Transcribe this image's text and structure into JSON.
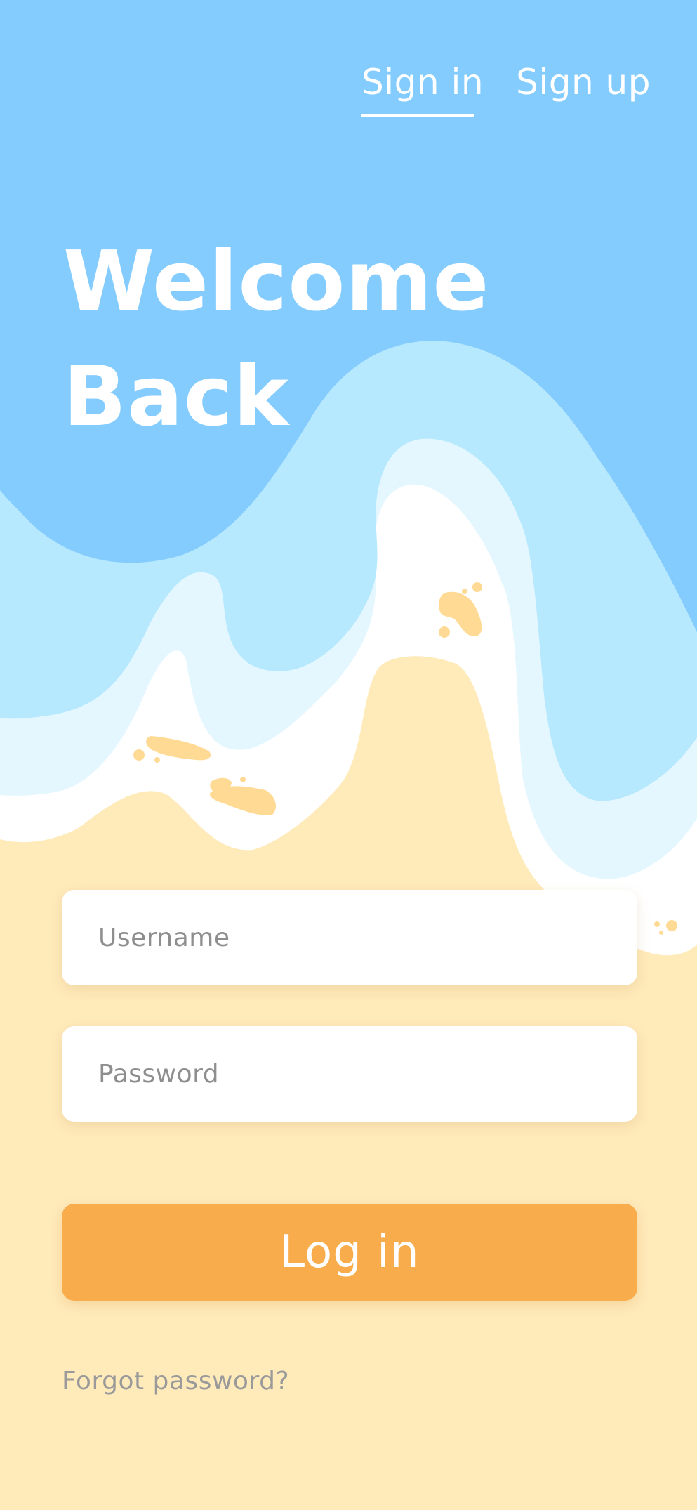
{
  "nav": {
    "tabs": [
      {
        "label": "Sign in",
        "active": true
      },
      {
        "label": "Sign up",
        "active": false
      }
    ]
  },
  "hero": {
    "title_line1": "Welcome",
    "title_line2": "Back"
  },
  "form": {
    "username": {
      "value": "",
      "placeholder": "Username"
    },
    "password": {
      "value": "",
      "placeholder": "Password"
    },
    "login_label": "Log in",
    "forgot_label": "Forgot password?"
  },
  "colors": {
    "sky": "#85CCFE",
    "wave_light": "#B7E9FE",
    "wave_pale": "#E4F7FF",
    "foam": "#FFFFFF",
    "sand": "#FFEABA",
    "sand_dots": "#FFDA94",
    "button": "#F9AC4C",
    "muted_text": "#9A9A9A"
  }
}
